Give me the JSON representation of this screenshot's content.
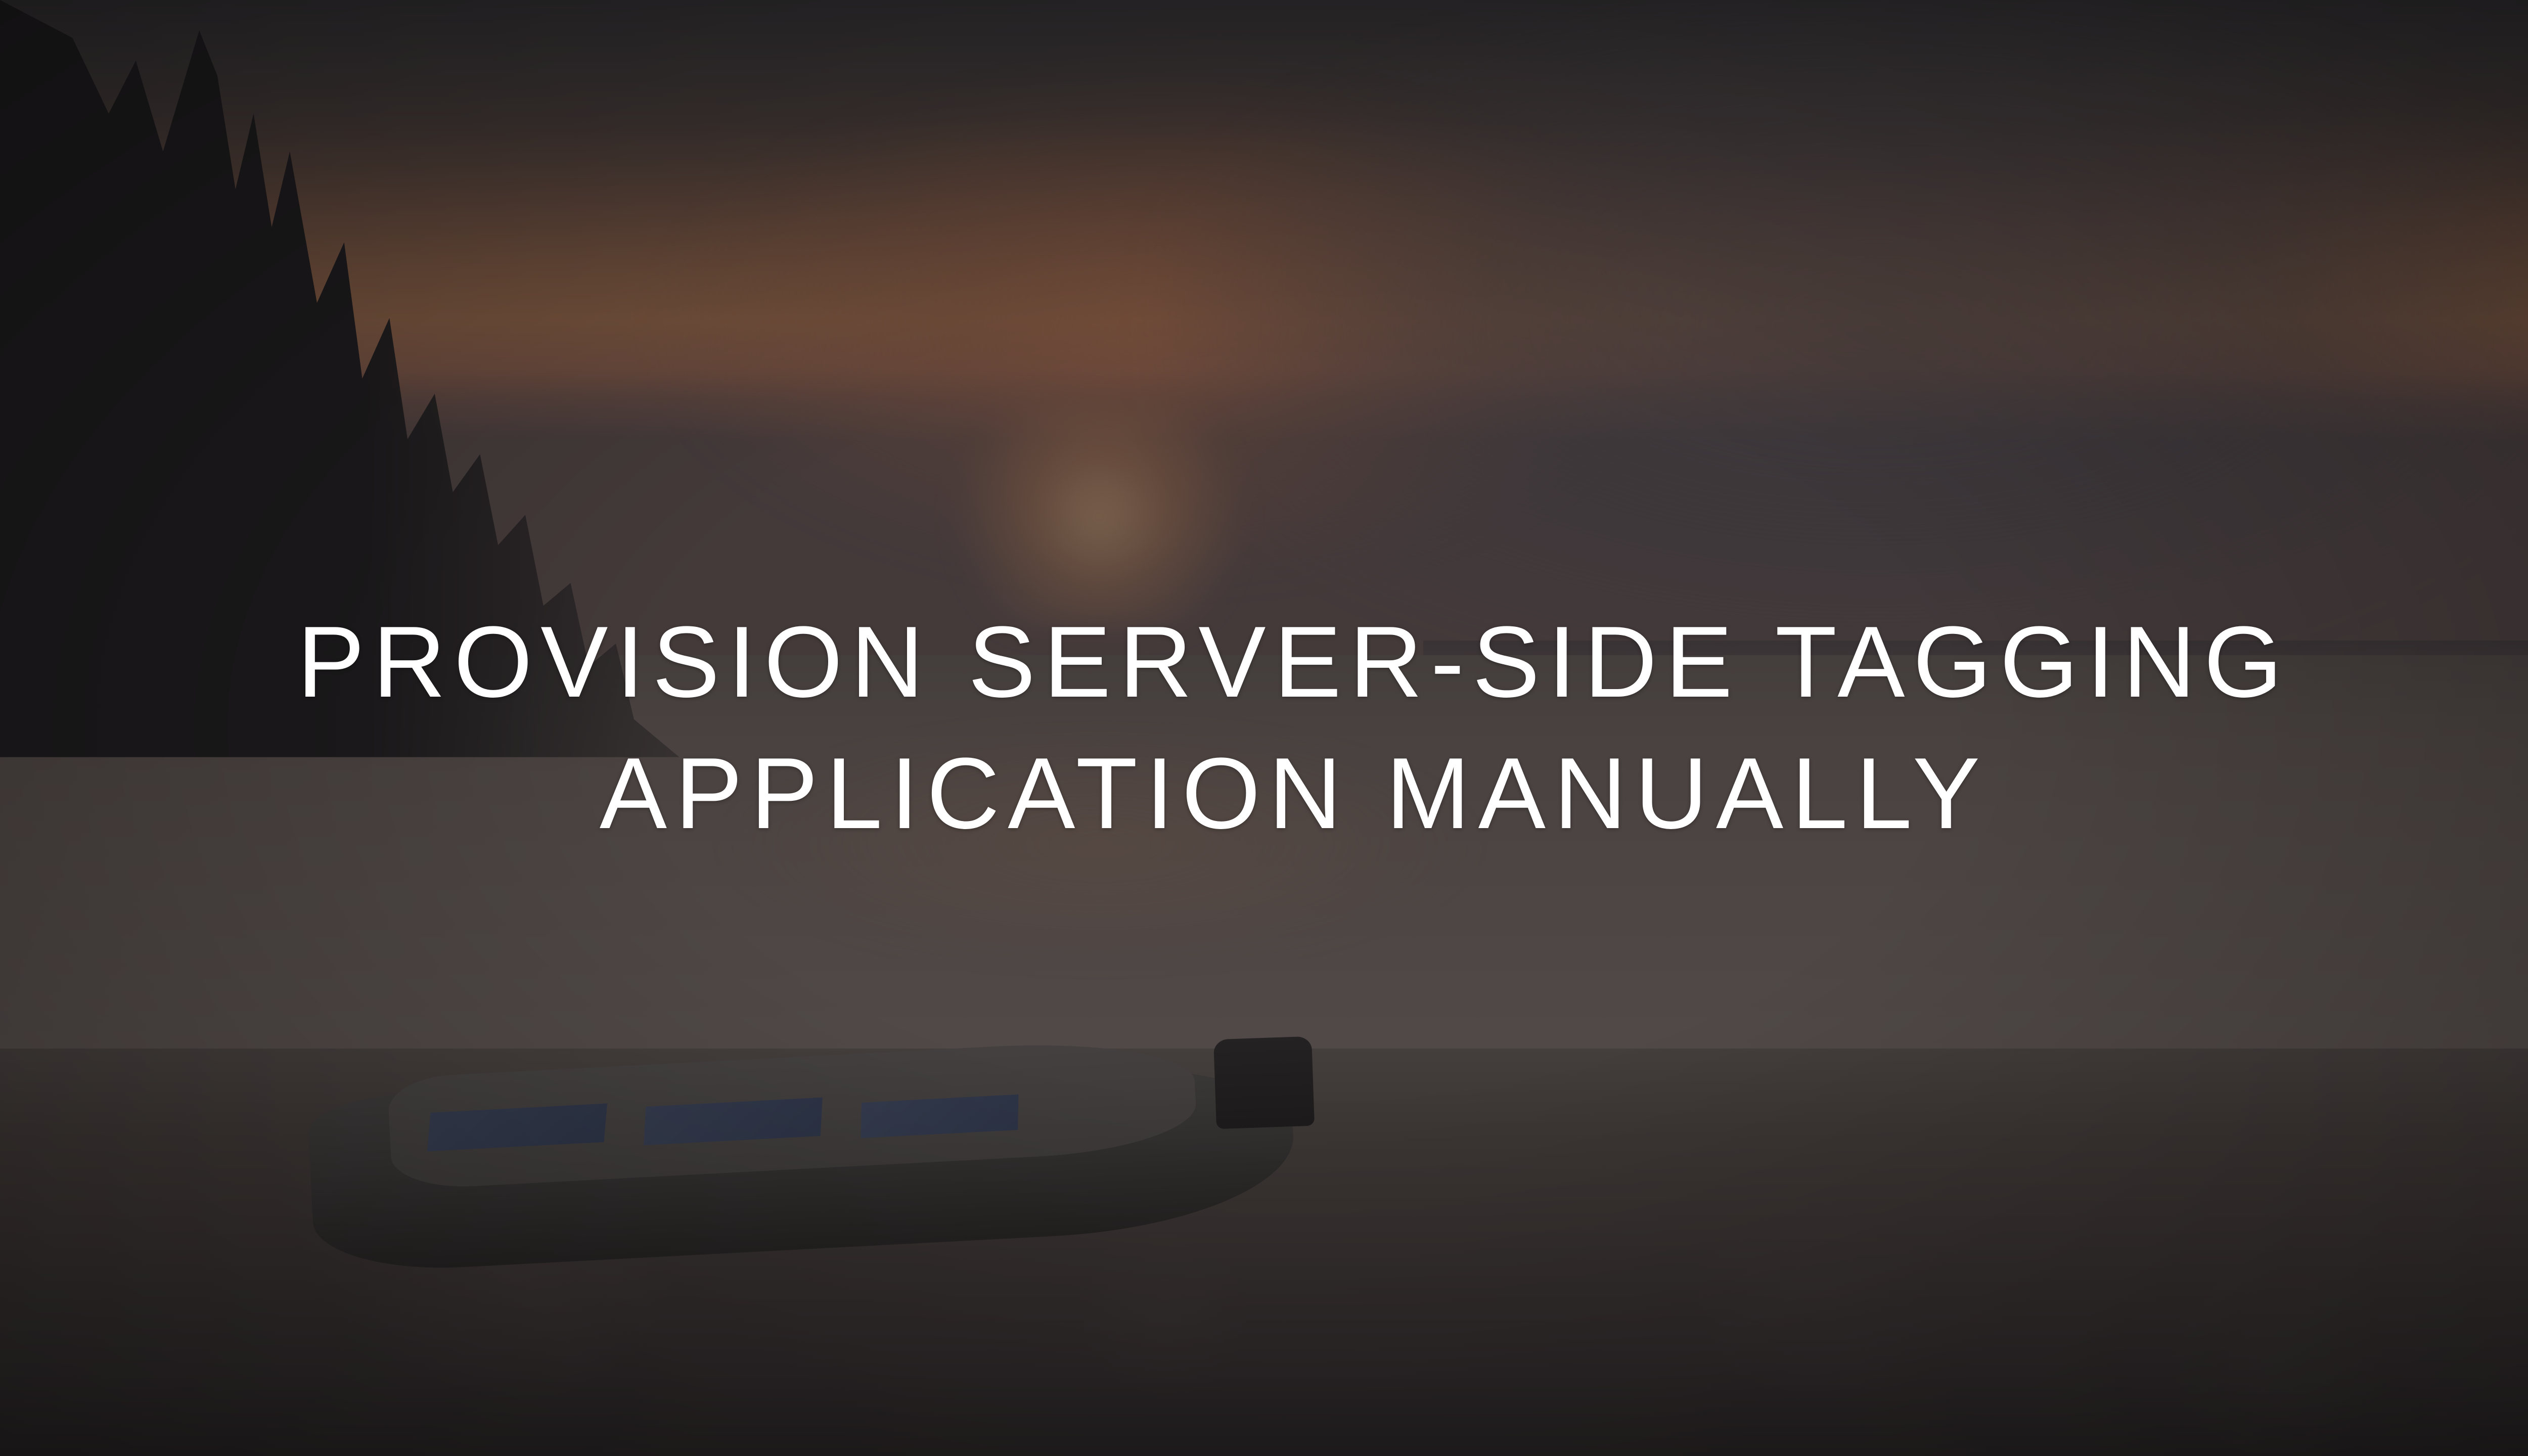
{
  "hero": {
    "title": "PROVISION SERVER-SIDE TAGGING APPLICATION MANUALLY"
  }
}
